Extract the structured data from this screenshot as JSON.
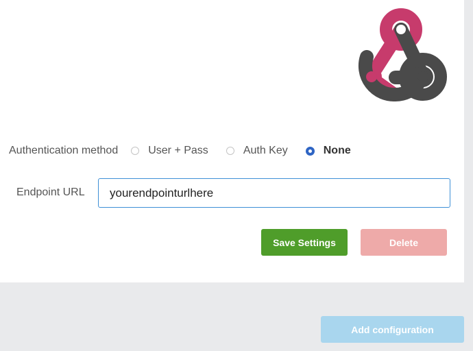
{
  "logo": {
    "icon": "webhook-icon",
    "colors": {
      "primary": "#c73b6c",
      "secondary": "#4a4a4a"
    }
  },
  "auth": {
    "label": "Authentication method",
    "options": [
      {
        "label": "User + Pass",
        "selected": false
      },
      {
        "label": "Auth Key",
        "selected": false
      },
      {
        "label": "None",
        "selected": true
      }
    ]
  },
  "endpoint": {
    "label": "Endpoint URL",
    "value": "yourendpointurlhere"
  },
  "actions": {
    "save_label": "Save Settings",
    "delete_label": "Delete"
  },
  "footer": {
    "add_label": "Add configuration"
  },
  "colors": {
    "save": "#4f9d2a",
    "delete": "#eeaaa9",
    "add": "#a9d6ee",
    "radio_checked": "#2f65c4",
    "input_border": "#3d8fd6"
  }
}
